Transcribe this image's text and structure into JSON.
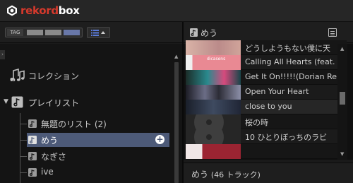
{
  "app": {
    "logo_prefix": "rekord",
    "logo_suffix": "box",
    "accent": "#d5392c"
  },
  "toolbar": {
    "tag_label": "TAG",
    "tag_swatches": [
      "#8a8a8a",
      "#8a8a8a",
      "#6877a8"
    ],
    "list_view_icon": "list-view-icon"
  },
  "tree": {
    "collection_label": "コレクション",
    "playlists_label": "プレイリスト",
    "playlists": [
      {
        "label": "無題のリスト (2)",
        "selected": false
      },
      {
        "label": "めう",
        "selected": true
      },
      {
        "label": "なぎさ",
        "selected": false
      },
      {
        "label": "ive",
        "selected": false
      }
    ]
  },
  "right_panel": {
    "title": "めう",
    "tracks": [
      {
        "title": "どうしようもない僕に天",
        "art": "#c79a8d"
      },
      {
        "title": "Calling All Hearts (feat. Rol",
        "art": "#e88a94"
      },
      {
        "title": "Get It On!!!!!(Dorian Remix)",
        "art": "#1f6b74"
      },
      {
        "title": "Open Your Heart",
        "art": "#5a5f7a"
      },
      {
        "title": "close to you",
        "art": "#2a3140"
      },
      {
        "title": "桜の時",
        "art": "#3c3c3c"
      },
      {
        "title": "10 ひとりぼっちのラビ",
        "art": "#3a3a3a"
      },
      {
        "title": "",
        "art": "#8b2230"
      }
    ],
    "footer_title": "めう",
    "footer_count": "(46 トラック)"
  }
}
